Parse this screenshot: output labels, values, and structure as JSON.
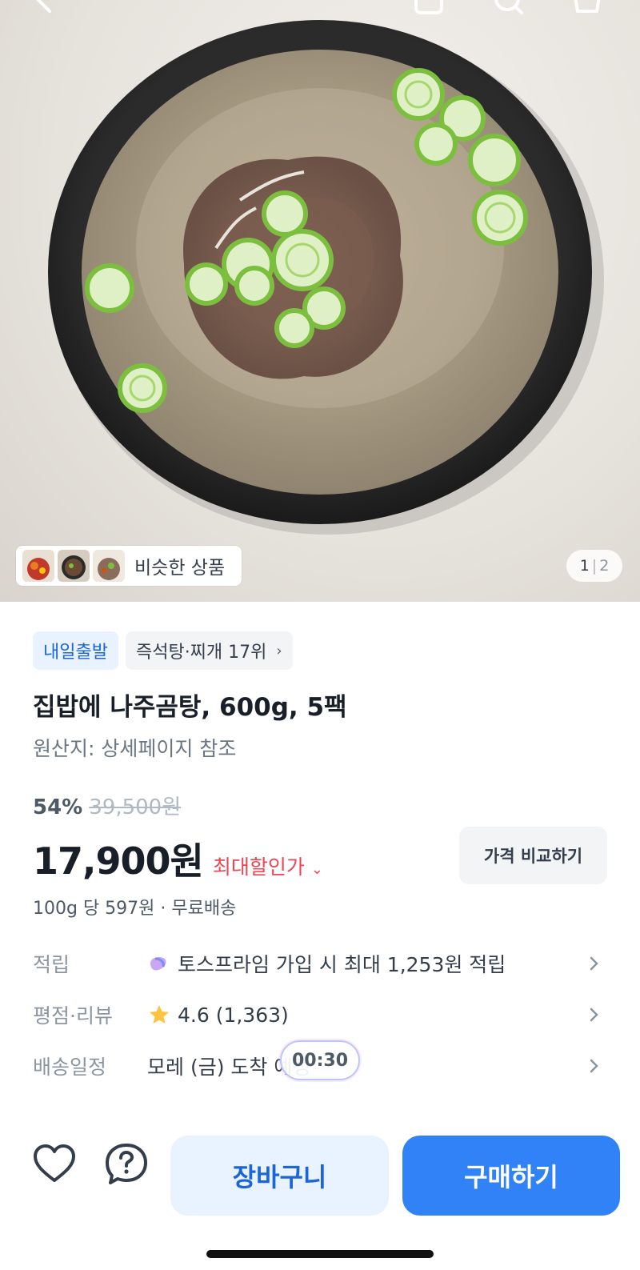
{
  "hero": {
    "similar_label": "비슷한 상품",
    "pager_current": "1",
    "pager_sep": "|",
    "pager_total": "2"
  },
  "product": {
    "tag_delivery": "내일출발",
    "tag_rank": "즉석탕·찌개 17위",
    "title": "집밥에 나주곰탕, 600g, 5팩",
    "origin": "원산지: 상세페이지 참조",
    "discount_pct": "54%",
    "original_price": "39,500원",
    "price": "17,900원",
    "max_discount_label": "최대할인가",
    "compare_label": "가격 비교하기",
    "unit_line": "100g 당 597원 · 무료배송"
  },
  "info": {
    "points_key": "적립",
    "points_value": "토스프라임 가입 시 최대 1,253원 적립",
    "rating_key": "평점·리뷰",
    "rating_value": "4.6 (1,363)",
    "delivery_key": "배송일정",
    "delivery_value": "모레 (금) 도착 예정"
  },
  "timer": "00:30",
  "bottom": {
    "cart_label": "장바구니",
    "buy_label": "구매하기"
  },
  "colors": {
    "accent": "#3182f6",
    "accent_light": "#e8f3ff",
    "discount_red": "#f04452",
    "star": "#ffc342"
  },
  "icons": {
    "back": "chevron-left-icon",
    "share": "share-icon",
    "search": "search-icon",
    "cart": "cart-icon",
    "heart": "heart-icon",
    "help": "question-icon",
    "star": "star-icon",
    "prime": "toss-prime-icon",
    "chevron": "chevron-right-icon"
  }
}
